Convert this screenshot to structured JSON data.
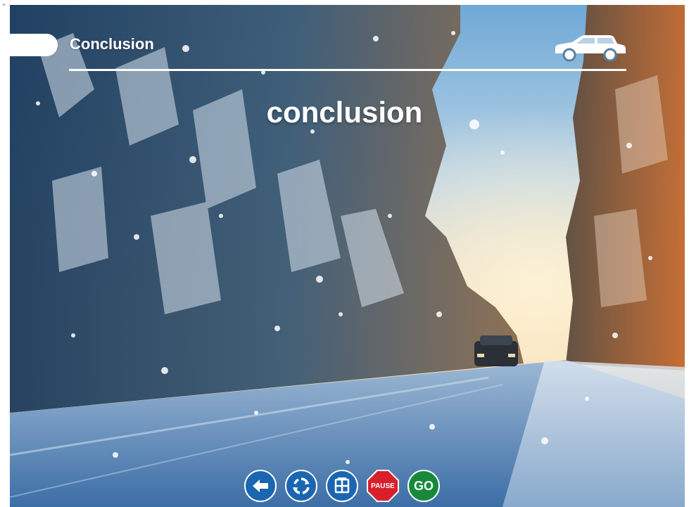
{
  "header": {
    "title": "Conclusion"
  },
  "slide": {
    "heading": "conclusion"
  },
  "nav": {
    "back_icon": "arrow-left-icon",
    "replay_icon": "refresh-icon",
    "menu_icon": "window-grid-icon",
    "pause_label": "PAUSE",
    "go_label": "GO"
  },
  "colors": {
    "nav_blue": "#1b66b0",
    "pause_red": "#d8202a",
    "go_green": "#168a3a",
    "text": "#ffffff"
  }
}
